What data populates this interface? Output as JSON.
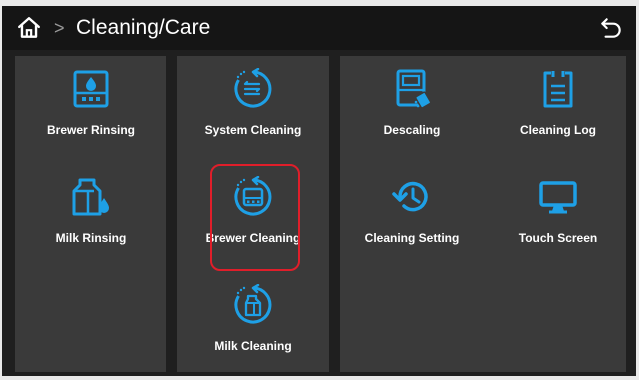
{
  "header": {
    "separator": ">",
    "title": "Cleaning/Care"
  },
  "colors": {
    "accent": "#1ea0e6",
    "highlight": "#e01e2a",
    "panel": "#3a3a3a",
    "topbar": "#151515"
  },
  "tiles": {
    "brewer_rinsing": {
      "label": "Brewer Rinsing",
      "icon": "brewer-rinsing-icon"
    },
    "milk_rinsing": {
      "label": "Milk Rinsing",
      "icon": "milk-rinsing-icon"
    },
    "system_cleaning": {
      "label": "System Cleaning",
      "icon": "system-cleaning-icon"
    },
    "brewer_cleaning": {
      "label": "Brewer Cleaning",
      "icon": "brewer-cleaning-icon"
    },
    "milk_cleaning": {
      "label": "Milk Cleaning",
      "icon": "milk-cleaning-icon"
    },
    "descaling": {
      "label": "Descaling",
      "icon": "descaling-icon"
    },
    "cleaning_log": {
      "label": "Cleaning Log",
      "icon": "clipboard-icon"
    },
    "cleaning_setting": {
      "label": "Cleaning Setting",
      "icon": "history-icon"
    },
    "touch_screen": {
      "label": "Touch Screen",
      "icon": "monitor-icon"
    }
  }
}
